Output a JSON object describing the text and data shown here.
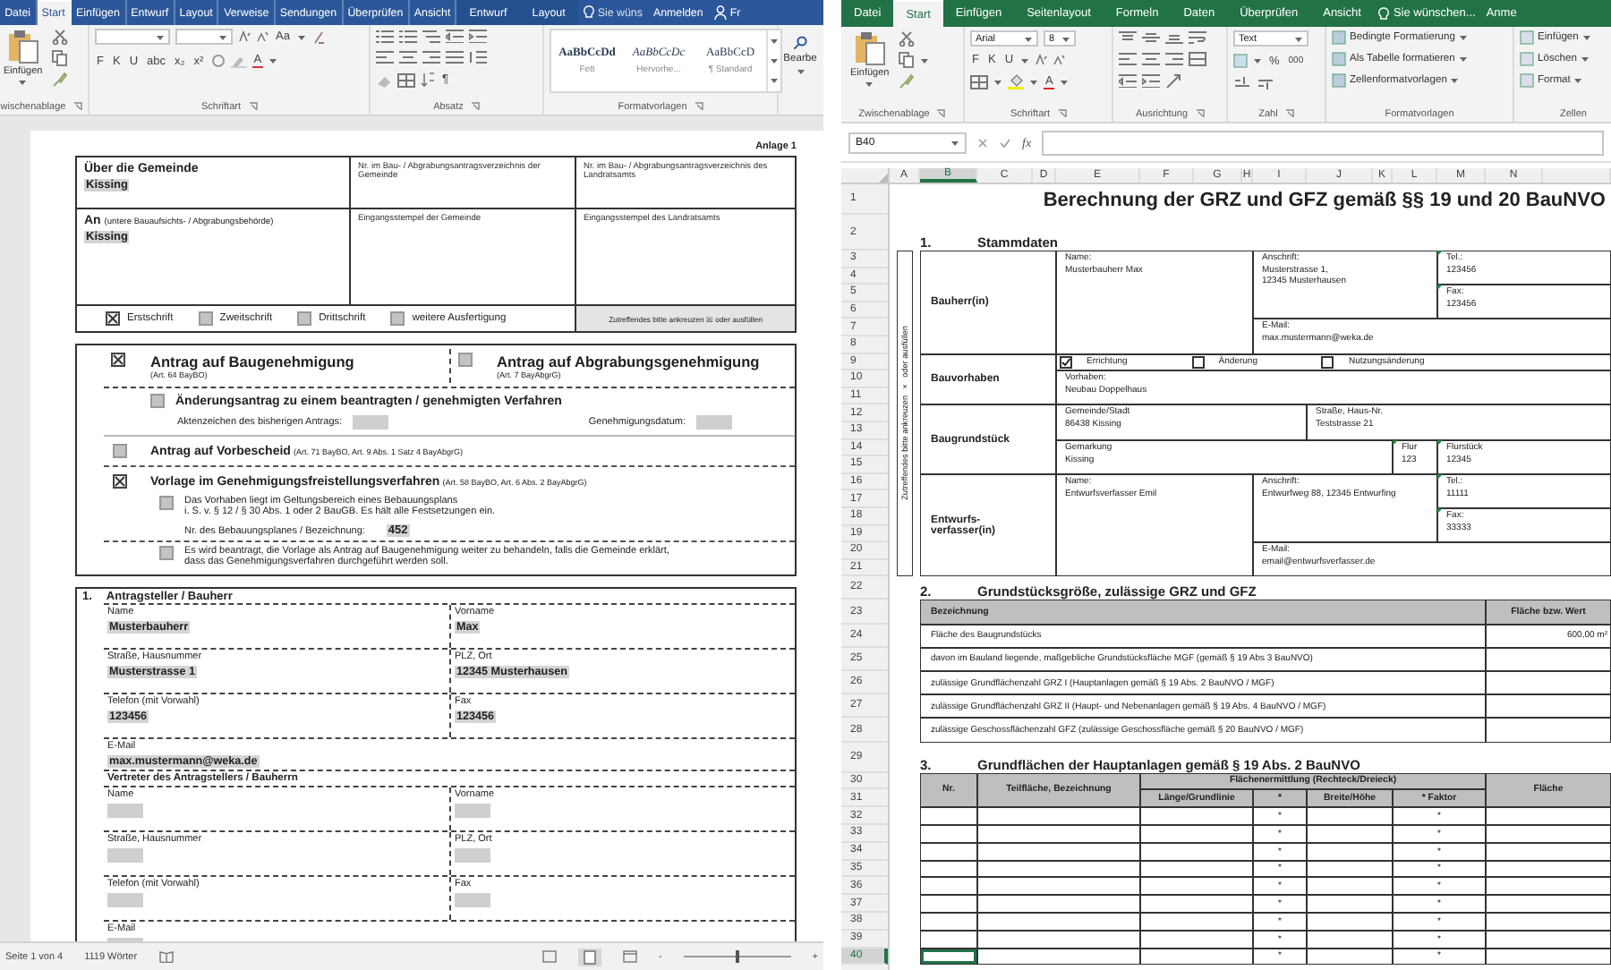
{
  "word": {
    "tabs": [
      {
        "label": "Datei",
        "selected": false,
        "contextual": false
      },
      {
        "label": "Start",
        "selected": true,
        "contextual": false
      },
      {
        "label": "Einfügen",
        "selected": false,
        "contextual": false
      },
      {
        "label": "Entwurf",
        "selected": false,
        "contextual": false
      },
      {
        "label": "Layout",
        "selected": false,
        "contextual": false
      },
      {
        "label": "Verweise",
        "selected": false,
        "contextual": false
      },
      {
        "label": "Sendungen",
        "selected": false,
        "contextual": false
      },
      {
        "label": "Überprüfen",
        "selected": false,
        "contextual": false
      },
      {
        "label": "Ansicht",
        "selected": false,
        "contextual": false
      },
      {
        "label": "Entwurf",
        "selected": false,
        "contextual": true
      },
      {
        "label": "Layout",
        "selected": false,
        "contextual": true
      }
    ],
    "tell_me": "Sie wüns",
    "sign_in": "Anmelden",
    "share": "Fr",
    "ribbon": {
      "paste": "Einfügen",
      "font_buttons": [
        "F",
        "K",
        "U",
        "abc",
        "x₂",
        "x²"
      ],
      "change_case": "Aa",
      "font_color": "A",
      "pilcrow": "¶",
      "styles": [
        {
          "sample": "AaBbCcDd",
          "name": "Fett"
        },
        {
          "sample": "AaBbCcDc",
          "name": "Hervorhe..."
        },
        {
          "sample": "AaBbCcD",
          "name": "¶ Standard"
        }
      ],
      "edit": "Bearbe",
      "groups": [
        "wischenablage",
        "Schriftart",
        "Absatz",
        "Formatvorlagen"
      ]
    },
    "document": {
      "annex": "Anlage 1",
      "recipient": [
        {
          "label": "Über die Gemeinde",
          "value": "Kissing"
        },
        {
          "label": "An",
          "note": "(untere Bauaufsichts- / Abgrabungsbehörde)",
          "value": "Kissing"
        }
      ],
      "register": [
        "Nr. im Bau- / Abgrabungsantragsverzeichnis der Gemeinde",
        "Nr. im Bau- / Abgrabungsantragsverzeichnis des Landratsamts"
      ],
      "stamps": [
        "Eingangsstempel der Gemeinde",
        "Eingangsstempel des Landratsamts"
      ],
      "copies": [
        {
          "label": "Erstschrift",
          "checked": true
        },
        {
          "label": "Zweitschrift",
          "checked": false
        },
        {
          "label": "Drittschrift",
          "checked": false
        },
        {
          "label": "weitere Ausfertigung",
          "checked": false
        }
      ],
      "copies_hint": "Zutreffendes bitte ankreuzen ☒ oder ausfüllen",
      "permits": [
        {
          "title": "Antrag auf Baugenehmigung",
          "ref": "(Art. 64 BayBO)",
          "checked": true
        },
        {
          "title": "Antrag auf Abgrabungsgenehmigung",
          "ref": "(Art. 7 BayAbgrG)",
          "checked": false
        }
      ],
      "amendment": {
        "title": "Änderungsantrag zu einem beantragten / genehmigten Verfahren",
        "checked": false,
        "fields": [
          "Aktenzeichen des bisherigen Antrags:",
          "Genehmigungsdatum:"
        ]
      },
      "preliminary": {
        "title": "Antrag auf Vorbescheid",
        "ref": "(Art. 71 BayBO, Art. 9 Abs. 1 Satz 4 BayAbgrG)",
        "checked": false
      },
      "exemption": {
        "title": "Vorlage im Genehmigungsfreistellungsverfahren",
        "ref": "(Art. 58 BayBO, Art. 6 Abs. 2 BayAbgrG)",
        "checked": true,
        "options": [
          {
            "lines": [
              "Das Vorhaben liegt im Geltungsbereich eines Bebauungsplans",
              "i. S. v. § 12 / § 30 Abs. 1 oder 2 BauGB. Es hält alle Festsetzungen ein."
            ],
            "checked": false,
            "field_label": "Nr. des Bebauungsplanes / Bezeichnung:",
            "field_value": "452"
          },
          {
            "lines": [
              "Es wird beantragt, die Vorlage als Antrag auf Baugenehmigung weiter zu behandeln, falls die Gemeinde erklärt,",
              "dass das Genehmigungsverfahren durchgeführt werden soll."
            ],
            "checked": false
          }
        ]
      },
      "applicant": {
        "number": "1.",
        "title": "Antragsteller / Bauherr",
        "fields": [
          [
            {
              "label": "Name",
              "value": "Musterbauherr"
            },
            {
              "label": "Vorname",
              "value": "Max"
            }
          ],
          [
            {
              "label": "Straße, Hausnummer",
              "value": "Musterstrasse 1"
            },
            {
              "label": "PLZ, Ort",
              "value": "12345 Musterhausen"
            }
          ],
          [
            {
              "label": "Telefon (mit Vorwahl)",
              "value": "123456"
            },
            {
              "label": "Fax",
              "value": "123456"
            }
          ],
          [
            {
              "label": "E-Mail",
              "value": "max.mustermann@weka.de"
            }
          ]
        ],
        "representative_title": "Vertreter des Antragstellers / Bauherrn",
        "representative_fields": [
          [
            {
              "label": "Name"
            },
            {
              "label": "Vorname"
            }
          ],
          [
            {
              "label": "Straße, Hausnummer"
            },
            {
              "label": "PLZ, Ort"
            }
          ],
          [
            {
              "label": "Telefon (mit Vorwahl)"
            },
            {
              "label": "Fax"
            }
          ],
          [
            {
              "label": "E-Mail"
            }
          ]
        ]
      }
    },
    "status": {
      "page": "Seite 1 von 4",
      "words": "1119 Wörter",
      "zoom_out": "-",
      "zoom_in": "+",
      "zoom": {
        "level": 0.5
      }
    }
  },
  "excel": {
    "tabs": [
      {
        "label": "Datei",
        "selected": false
      },
      {
        "label": "Start",
        "selected": true
      },
      {
        "label": "Einfügen",
        "selected": false
      },
      {
        "label": "Seitenlayout",
        "selected": false
      },
      {
        "label": "Formeln",
        "selected": false
      },
      {
        "label": "Daten",
        "selected": false
      },
      {
        "label": "Überprüfen",
        "selected": false
      },
      {
        "label": "Ansicht",
        "selected": false
      }
    ],
    "tell_me": "Sie wünschen...",
    "sign_in": "Anme",
    "ribbon": {
      "paste": "Einfügen",
      "font": "Arial",
      "size": "8",
      "font_buttons": [
        "F",
        "K",
        "U"
      ],
      "font_color": "A",
      "number_format": "Text",
      "percent": "%",
      "thousands": "000",
      "styles": [
        "Bedingte Formatierung",
        "Als Tabelle formatieren",
        "Zellenformatvorlagen"
      ],
      "cells": [
        "Einfügen",
        "Löschen",
        "Format"
      ],
      "groups": [
        "Zwischenablage",
        "Schriftart",
        "Ausrichtung",
        "Zahl",
        "Formatvorlagen",
        "Zellen"
      ]
    },
    "name_box": "B40",
    "function_label": "fx",
    "columns": [
      {
        "label": "A",
        "selected": false
      },
      {
        "label": "B",
        "selected": true
      },
      {
        "label": "C",
        "selected": false
      },
      {
        "label": "D",
        "selected": false
      },
      {
        "label": "E",
        "selected": false
      },
      {
        "label": "F",
        "selected": false
      },
      {
        "label": "G",
        "selected": false
      },
      {
        "label": "H",
        "selected": false
      },
      {
        "label": "I",
        "selected": false
      },
      {
        "label": "J",
        "selected": false
      },
      {
        "label": "K",
        "selected": false
      },
      {
        "label": "L",
        "selected": false
      },
      {
        "label": "M",
        "selected": false
      },
      {
        "label": "N",
        "selected": false
      }
    ],
    "rows": [
      {
        "label": "1",
        "selected": false
      },
      {
        "label": "2",
        "selected": false
      },
      {
        "label": "3",
        "selected": false
      },
      {
        "label": "4",
        "selected": false
      },
      {
        "label": "5",
        "selected": false
      },
      {
        "label": "6",
        "selected": false
      },
      {
        "label": "7",
        "selected": false
      },
      {
        "label": "8",
        "selected": false
      },
      {
        "label": "9",
        "selected": false
      },
      {
        "label": "10",
        "selected": false
      },
      {
        "label": "11",
        "selected": false
      },
      {
        "label": "12",
        "selected": false
      },
      {
        "label": "13",
        "selected": false
      },
      {
        "label": "14",
        "selected": false
      },
      {
        "label": "15",
        "selected": false
      },
      {
        "label": "16",
        "selected": false
      },
      {
        "label": "17",
        "selected": false
      },
      {
        "label": "18",
        "selected": false
      },
      {
        "label": "19",
        "selected": false
      },
      {
        "label": "20",
        "selected": false
      },
      {
        "label": "21",
        "selected": false
      },
      {
        "label": "22",
        "selected": false
      },
      {
        "label": "23",
        "selected": false
      },
      {
        "label": "24",
        "selected": false
      },
      {
        "label": "25",
        "selected": false
      },
      {
        "label": "26",
        "selected": false
      },
      {
        "label": "27",
        "selected": false
      },
      {
        "label": "28",
        "selected": false
      },
      {
        "label": "29",
        "selected": false
      },
      {
        "label": "30",
        "selected": false
      },
      {
        "label": "31",
        "selected": false
      },
      {
        "label": "32",
        "selected": false
      },
      {
        "label": "33",
        "selected": false
      },
      {
        "label": "34",
        "selected": false
      },
      {
        "label": "35",
        "selected": false
      },
      {
        "label": "36",
        "selected": false
      },
      {
        "label": "37",
        "selected": false
      },
      {
        "label": "38",
        "selected": false
      },
      {
        "label": "39",
        "selected": false
      },
      {
        "label": "40",
        "selected": true
      }
    ],
    "sheet": {
      "title": "Berechnung der GRZ und GFZ gemäß §§ 19 und 20 BauNVO",
      "side_note": "Zutreffendes bitte ankreuzen  ×  oder ausfüllen",
      "sections": [
        {
          "number": "1.",
          "title": "Stammdaten"
        },
        {
          "number": "2.",
          "title": "Grundstücksgröße, zulässige GRZ und GFZ"
        },
        {
          "number": "3.",
          "title": "Grundflächen der Hauptanlagen gemäß § 19 Abs. 2 BauNVO"
        }
      ],
      "owner": {
        "heading": "Bauherr(in)",
        "cells": [
          {
            "label": "Name:",
            "value": "Musterbauherr Max"
          },
          {
            "label": "Anschrift:",
            "value": "Musterstrasse 1,\n12345 Musterhausen"
          },
          {
            "label": "Tel.:",
            "value": "123456",
            "text_number": true
          },
          {
            "label": "Fax:",
            "value": "123456",
            "text_number": true
          },
          {
            "label": "E-Mail:",
            "value": "max.mustermann@weka.de"
          }
        ]
      },
      "project": {
        "heading": "Bauvorhaben",
        "types": [
          {
            "label": "Errichtung",
            "checked": true
          },
          {
            "label": "Änderung",
            "checked": false
          },
          {
            "label": "Nutzungsänderung",
            "checked": false
          }
        ],
        "label": "Vorhaben:",
        "value": "Neubau Doppelhaus"
      },
      "plot": {
        "heading": "Baugrundstück",
        "cells": [
          {
            "label": "Gemeinde/Stadt",
            "value": "86438 Kissing"
          },
          {
            "label": "Straße, Haus-Nr.",
            "value": "Teststrasse 21"
          },
          {
            "label": "Gemarkung",
            "value": "Kissing"
          },
          {
            "label": "Flur",
            "value": "123",
            "text_number": true
          },
          {
            "label": "Flurstück",
            "value": "12345",
            "text_number": true
          }
        ]
      },
      "designer": {
        "heading": "Entwurfs-\nverfasser(in)",
        "cells": [
          {
            "label": "Name:",
            "value": "Entwurfsverfasser Emil"
          },
          {
            "label": "Anschrift:",
            "value": "Entwurfweg 88, 12345 Entwurfing"
          },
          {
            "label": "Tel.:",
            "value": "11111",
            "text_number": true
          },
          {
            "label": "Fax:",
            "value": "33333",
            "text_number": true
          },
          {
            "label": "E-Mail:",
            "value": "email@entwurfsverfasser.de"
          }
        ]
      },
      "area_table": {
        "columns": [
          "Bezeichnung",
          "Fläche bzw. Wert"
        ],
        "rows": [
          {
            "label": "Fläche des Baugrundstücks",
            "value": "600,00 m²"
          },
          {
            "label": "davon im Bauland liegende, maßgebliche Grundstücksfläche MGF (gemäß § 19 Abs 3 BauNVO)"
          },
          {
            "label": "zulässige Grundflächenzahl GRZ I (Hauptanlagen gemäß § 19 Abs. 2 BauNVO / MGF)"
          },
          {
            "label": "zulässige Grundflächenzahl GRZ II (Haupt- und Nebenanlagen gemäß § 19 Abs. 4 BauNVO / MGF)"
          },
          {
            "label": "zulässige Geschossflächenzahl GFZ (zulässige Geschossfläche gemäß § 20 BauNVO / MGF)"
          }
        ]
      },
      "main_table": {
        "columns": [
          "Nr.",
          "Teilfläche, Bezeichnung",
          "Flächenermittlung (Rechteck/Dreieck)",
          "Fläche"
        ],
        "sub_columns": [
          "Länge/Grundlinie",
          "*",
          "Breite/Höhe",
          "* Faktor"
        ],
        "rows": [
          {
            "op1": "*",
            "op2": "*"
          },
          {
            "op1": "*",
            "op2": "*"
          },
          {
            "op1": "*",
            "op2": "*"
          },
          {
            "op1": "*",
            "op2": "*"
          },
          {
            "op1": "*",
            "op2": "*"
          },
          {
            "op1": "*",
            "op2": "*"
          },
          {
            "op1": "*",
            "op2": "*"
          },
          {
            "op1": "*",
            "op2": "*"
          },
          {
            "op1": "*",
            "op2": "*"
          }
        ]
      }
    }
  }
}
